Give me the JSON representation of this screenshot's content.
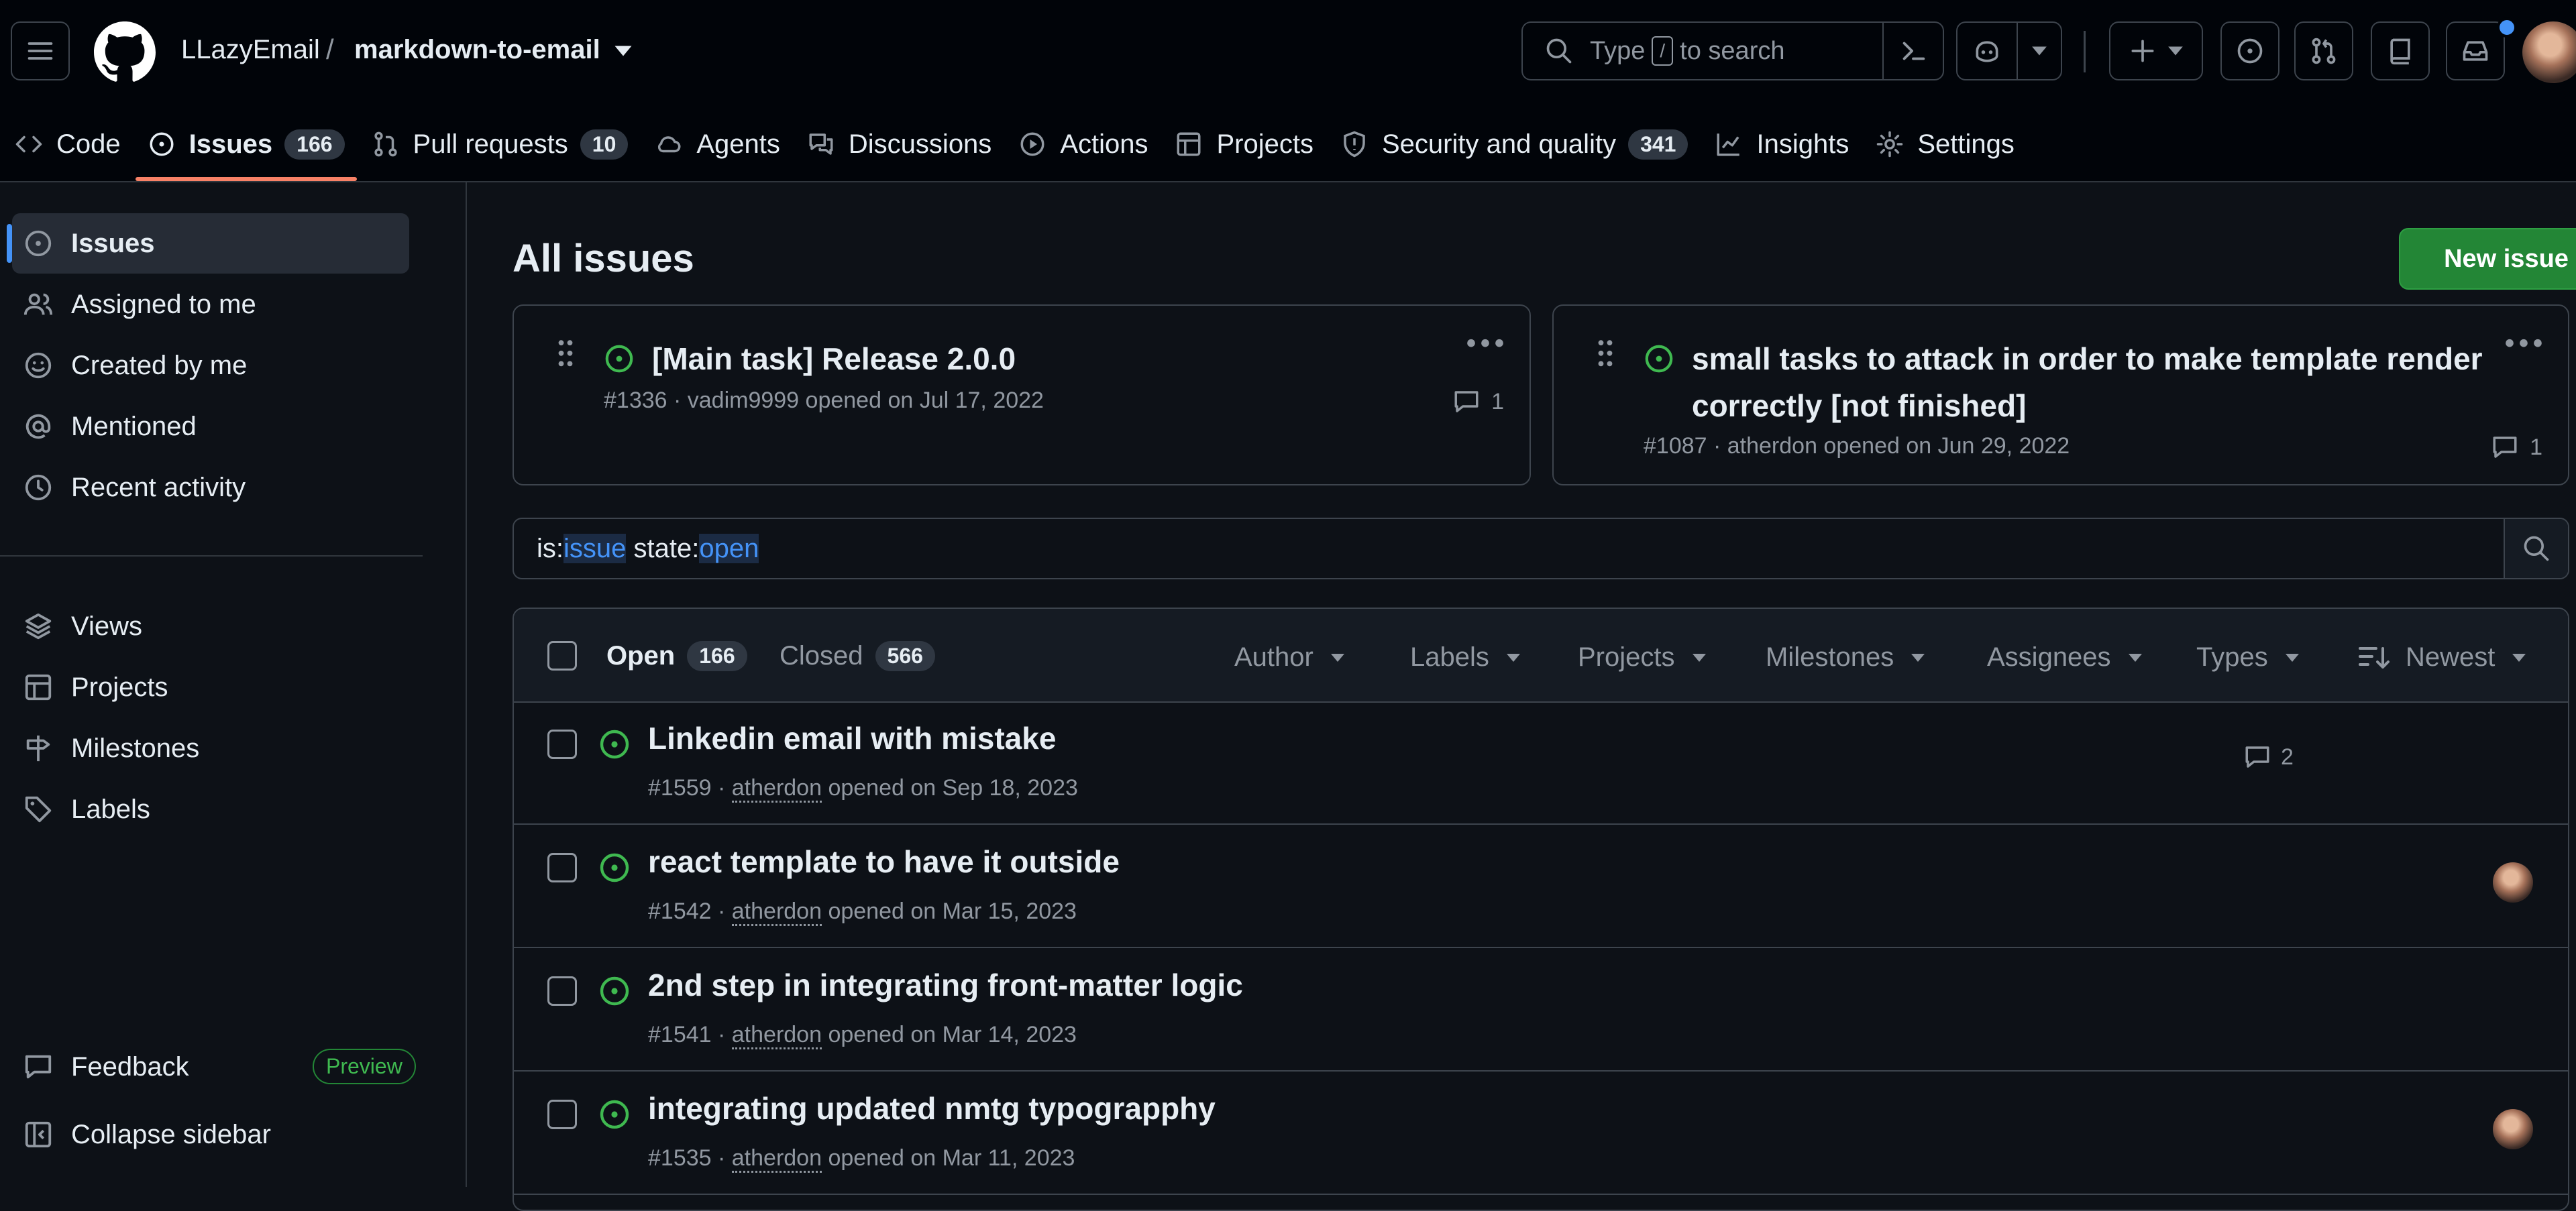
{
  "header": {
    "owner": "LLazyEmail",
    "separator": "/",
    "repo": "markdown-to-email",
    "search_placeholder_pre": "Type",
    "search_key": "/",
    "search_placeholder_post": "to search"
  },
  "tabs": [
    {
      "label": "Code",
      "icon": "code-icon"
    },
    {
      "label": "Issues",
      "count": "166",
      "icon": "issue-opened-icon",
      "active": true
    },
    {
      "label": "Pull requests",
      "count": "10",
      "icon": "git-pull-request-icon"
    },
    {
      "label": "Agents",
      "icon": "agent-cloud-icon"
    },
    {
      "label": "Discussions",
      "icon": "comment-discussion-icon"
    },
    {
      "label": "Actions",
      "icon": "play-icon"
    },
    {
      "label": "Projects",
      "icon": "table-icon"
    },
    {
      "label": "Security and quality",
      "count": "341",
      "icon": "shield-icon"
    },
    {
      "label": "Insights",
      "icon": "graph-icon"
    },
    {
      "label": "Settings",
      "icon": "gear-icon"
    }
  ],
  "sidebar": {
    "top_items": [
      {
        "label": "Issues",
        "icon": "issue-opened-icon",
        "active": true
      },
      {
        "label": "Assigned to me",
        "icon": "people-icon"
      },
      {
        "label": "Created by me",
        "icon": "smiley-icon"
      },
      {
        "label": "Mentioned",
        "icon": "mention-icon"
      },
      {
        "label": "Recent activity",
        "icon": "clock-icon"
      }
    ],
    "bottom_items": [
      {
        "label": "Views",
        "icon": "stack-icon"
      },
      {
        "label": "Projects",
        "icon": "table-icon"
      },
      {
        "label": "Milestones",
        "icon": "milestone-icon"
      },
      {
        "label": "Labels",
        "icon": "tag-icon"
      }
    ],
    "feedback": "Feedback",
    "preview_badge": "Preview",
    "collapse": "Collapse sidebar"
  },
  "main": {
    "title": "All issues",
    "new_issue": "New issue",
    "pinned": [
      {
        "title": "[Main task] Release 2.0.0",
        "meta": "#1336 · vadim9999 opened on Jul 17, 2022",
        "comments": "1"
      },
      {
        "title": "small tasks to attack in order to make template render correctly [not finished]",
        "meta": "#1087 · atherdon opened on Jun 29, 2022",
        "comments": "1"
      }
    ],
    "filter": {
      "q1": "is:",
      "q2": "issue",
      "q3": " state:",
      "q4": "open"
    },
    "list_header": {
      "open_label": "Open",
      "open_count": "166",
      "closed_label": "Closed",
      "closed_count": "566",
      "filters": [
        "Author",
        "Labels",
        "Projects",
        "Milestones",
        "Assignees",
        "Types"
      ],
      "sort": "Newest"
    },
    "issues": [
      {
        "title": "Linkedin email with mistake",
        "number": "#1559 · ",
        "author": "atherdon",
        "opened": " opened on Sep 18, 2023",
        "comments": "2"
      },
      {
        "title": "react template to have it outside",
        "number": "#1542 · ",
        "author": "atherdon",
        "opened": " opened on Mar 15, 2023"
      },
      {
        "title": "2nd step in integrating front-matter logic",
        "number": "#1541 · ",
        "author": "atherdon",
        "opened": " opened on Mar 14, 2023"
      },
      {
        "title": "integrating updated nmtg typograpphy",
        "number": "#1535 · ",
        "author": "atherdon",
        "opened": " opened on Mar 11, 2023"
      }
    ]
  },
  "colors": {
    "background": "#0d1117",
    "header_bg": "#010409",
    "accent_green": "#238636",
    "open_icon": "#3fb950",
    "active_tab_underline": "#f78166",
    "link_blue": "#4493f8"
  }
}
